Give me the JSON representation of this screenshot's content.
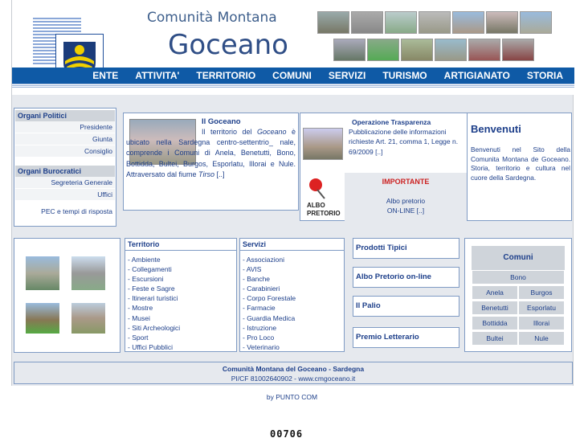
{
  "header": {
    "title": "Comunità Montana",
    "name": "Goceano"
  },
  "nav": [
    "ENTE",
    "ATTIVITA'",
    "TERRITORIO",
    "COMUNI",
    "SERVIZI",
    "TURISMO",
    "ARTIGIANATO",
    "STORIA"
  ],
  "sidebar": {
    "politici_title": "Organi Politici",
    "politici": [
      "Presidente",
      "Giunta",
      "Consiglio"
    ],
    "burocratici_title": "Organi Burocratici",
    "burocratici": [
      "Segreteria Generale",
      "Uffici"
    ],
    "pec": "PEC e tempi di risposta"
  },
  "intro": {
    "title": "Il Goceano",
    "text_a": "Il territorio del ",
    "text_em": "Goceano",
    "text_b": " è ubicato nella Sardegna centro-settentrio_ nale, comprende i Comuni di Anela, Benetutti, Bono, Bottidda, Bultei, Burgos, Esporlatu, Illorai e Nule. Attraversato dal fiume ",
    "text_em2": "Tirso",
    "text_c": " [..]"
  },
  "trasparenza": {
    "title": "Operazione Trasparenza",
    "text": "Pubblicazione delle informazioni richieste Art. 21, comma 1, Legge n. 69/2009 [..]"
  },
  "albo": {
    "important": "IMPORTANTE",
    "line1": "Albo pretorio",
    "line2": "ON-LINE [..]",
    "badge_1": "ALBO",
    "badge_2": "PRETORIO"
  },
  "welcome": {
    "title": "Benvenuti",
    "text": "Benvenuti nel Sito della Comunita Montana de Goceano. Storia, territorio e cultura nel cuore della Sardegna."
  },
  "territorio": {
    "title": "Territorio",
    "items": [
      "- Ambiente",
      "- Collegamenti",
      "- Escursioni",
      "- Feste e Sagre",
      "- Itinerari turistici",
      "- Mostre",
      "- Musei",
      "- Siti Archeologici",
      "- Sport",
      "- Uffici Pubblici"
    ]
  },
  "servizi": {
    "title": "Servizi",
    "items": [
      "- Associazioni",
      "- AVIS",
      "- Banche",
      "- Carabinieri",
      "- Corpo Forestale",
      "- Farmacie",
      "- Guardia Medica",
      "- Istruzione",
      "- Pro Loco",
      "- Veterinario"
    ]
  },
  "promo": [
    "Prodotti Tipici",
    "Albo Pretorio on-line",
    "Il Palio",
    "Premio Letterario"
  ],
  "comuni": {
    "title": "Comuni",
    "single": "Bono",
    "pairs": [
      [
        "Anela",
        "Burgos"
      ],
      [
        "Benetutti",
        "Esporlatu"
      ],
      [
        "Bottidda",
        "Illorai"
      ],
      [
        "Bultei",
        "Nule"
      ]
    ]
  },
  "footer": {
    "line1": "Comunità Montana del Goceano - Sardegna",
    "line2": "PI/CF 81002640902 - www.cmgoceano.it"
  },
  "credit": "by PUNTO COM",
  "counter": "00706",
  "colors": {
    "nav_bg": "#0f5aa6",
    "accent": "#1d3f8a",
    "important": "#cc2222"
  }
}
